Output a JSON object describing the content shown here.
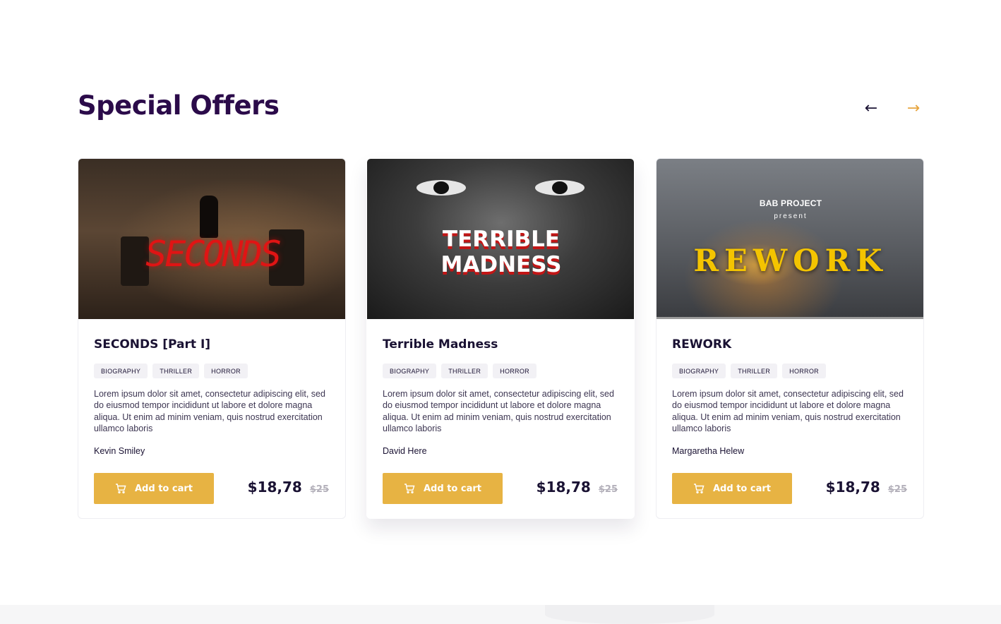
{
  "section": {
    "title": "Special Offers",
    "nav": {
      "prev_icon": "arrow-left-icon",
      "next_icon": "arrow-right-icon",
      "prev_glyph": "←",
      "next_glyph": "→"
    }
  },
  "colors": {
    "heading": "#2b0b4a",
    "accent": "#e7b343",
    "next_arrow": "#e7a53f",
    "text": "#1a1233",
    "muted_price": "#b3b0ba"
  },
  "cards": [
    {
      "cover_title": "SECONDS",
      "title": "SECONDS [Part I]",
      "tags": [
        "BIOGRAPHY",
        "THRILLER",
        "HORROR"
      ],
      "description": "Lorem ipsum dolor sit amet, consectetur adipiscing elit, sed do eiusmod tempor incididunt ut labore et dolore magna aliqua. Ut enim ad minim veniam, quis nostrud exercitation ullamco laboris",
      "author": "Kevin Smiley",
      "cart_label": "Add to cart",
      "price": "$18,78",
      "old_price": "$25"
    },
    {
      "cover_title_line1": "TERRIBLE",
      "cover_title_line2": "MADNESS",
      "title": "Terrible Madness",
      "tags": [
        "BIOGRAPHY",
        "THRILLER",
        "HORROR"
      ],
      "description": "Lorem ipsum dolor sit amet, consectetur adipiscing elit, sed do eiusmod tempor incididunt ut labore et dolore magna aliqua. Ut enim ad minim veniam, quis nostrud exercitation ullamco laboris",
      "author": "David Here",
      "cart_label": "Add to cart",
      "price": "$18,78",
      "old_price": "$25"
    },
    {
      "cover_brand": "BAB PROJECT",
      "cover_present": "present",
      "cover_title": "REWORK",
      "title": "REWORK",
      "tags": [
        "BIOGRAPHY",
        "THRILLER",
        "HORROR"
      ],
      "description": "Lorem ipsum dolor sit amet, consectetur adipiscing elit, sed do eiusmod tempor incididunt ut labore et dolore magna aliqua. Ut enim ad minim veniam, quis nostrud exercitation ullamco laboris",
      "author": "Margaretha Helew",
      "cart_label": "Add to cart",
      "price": "$18,78",
      "old_price": "$25"
    }
  ]
}
